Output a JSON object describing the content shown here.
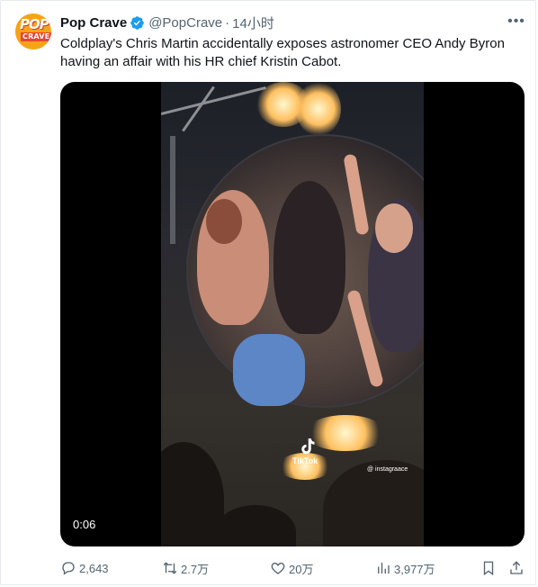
{
  "tweet": {
    "author_name": "Pop Crave",
    "handle": "@PopCrave",
    "separator": "·",
    "time": "14小时",
    "text": "Coldplay's Chris Martin accidentally exposes astronomer CEO Andy Byron having an affair with his HR chief Kristin Cabot.",
    "avatar": {
      "top_text": "POP",
      "bottom_text": "CRAVE",
      "color": "#f5a418"
    },
    "verified_color": "#1d9bf0"
  },
  "video": {
    "duration": "0:06",
    "watermark_brand": "TikTok",
    "watermark_user": "@ instagraace"
  },
  "actions": {
    "replies": "2,643",
    "reposts": "2.7万",
    "likes": "20万",
    "views": "3,977万",
    "icons": [
      "reply-icon",
      "repost-icon",
      "like-icon",
      "views-icon",
      "bookmark-icon",
      "share-icon"
    ]
  },
  "colors": {
    "text": "#0f1419",
    "muted": "#536471",
    "accent": "#1d9bf0"
  }
}
